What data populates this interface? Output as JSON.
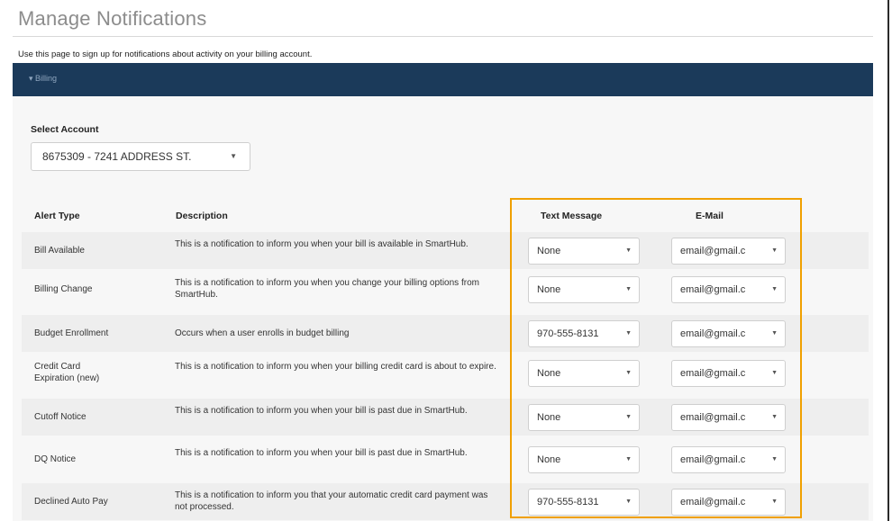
{
  "page": {
    "title": "Manage Notifications",
    "intro": "Use this page to sign up for notifications about activity on your billing account.",
    "section_label": "▾ Billing"
  },
  "account": {
    "label": "Select Account",
    "selected": "8675309 - 7241 ADDRESS ST."
  },
  "table": {
    "headers": {
      "alert_type": "Alert Type",
      "description": "Description",
      "text_message": "Text Message",
      "email": "E-Mail"
    },
    "rows": [
      {
        "type": "Bill Available",
        "description": "This is a notification to inform you when your bill is available in SmartHub.",
        "text": "None",
        "email": "email@gmail.c"
      },
      {
        "type": "Billing Change",
        "description": "This is a notification to inform you when you change your billing options from SmartHub.",
        "text": "None",
        "email": "email@gmail.c"
      },
      {
        "type": "Budget Enrollment",
        "description": "Occurs when a user enrolls in budget billing",
        "text": "970-555-8131",
        "email": "email@gmail.c"
      },
      {
        "type": "Credit Card Expiration (new)",
        "description": "This is a notification to inform you when your billing credit card is about to expire.",
        "text": "None",
        "email": "email@gmail.c"
      },
      {
        "type": "Cutoff Notice",
        "description": "This is a notification to inform you when your bill is past due in SmartHub.",
        "text": "None",
        "email": "email@gmail.c"
      },
      {
        "type": "DQ Notice",
        "description": "This is a notification to inform you when your bill is past due in SmartHub.",
        "text": "None",
        "email": "email@gmail.c"
      },
      {
        "type": "Declined Auto Pay",
        "description": "This is a notification to inform you that your automatic credit card payment was not processed.",
        "text": "970-555-8131",
        "email": "email@gmail.c"
      }
    ]
  },
  "colors": {
    "section_bar": "#1b3a5a",
    "highlight": "#f0a000",
    "title": "#8c8c8c"
  }
}
